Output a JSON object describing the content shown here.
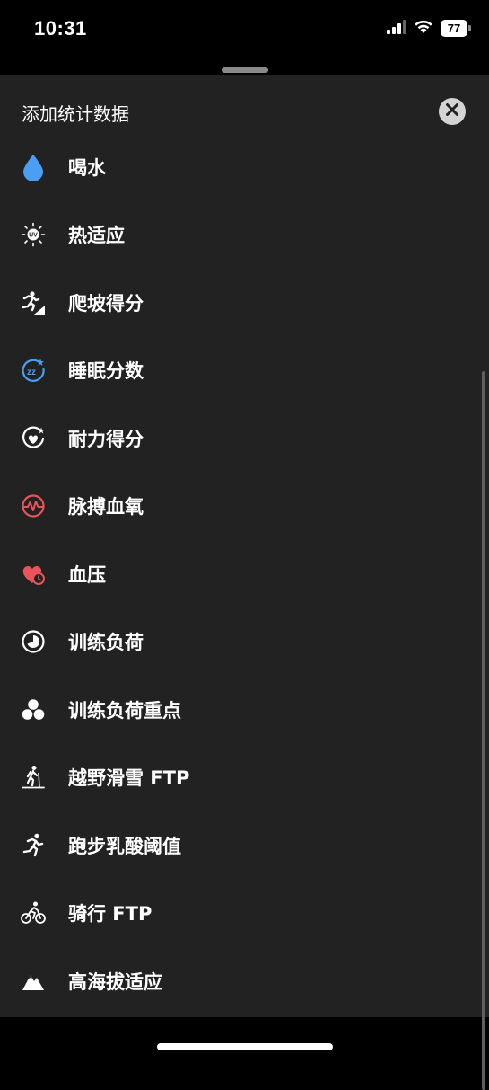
{
  "status_bar": {
    "time": "10:31",
    "battery_level": "77",
    "icons": [
      "cellular-signal-icon",
      "wifi-icon",
      "battery-icon"
    ]
  },
  "sheet": {
    "title": "添加统计数据",
    "close_icon": "close-icon"
  },
  "items": [
    {
      "label": "喝水",
      "icon": "water-drop-icon",
      "color": "#4a9ff5"
    },
    {
      "label": "热适应",
      "icon": "uv-sun-icon",
      "color": "#ffffff"
    },
    {
      "label": "爬坡得分",
      "icon": "climb-runner-icon",
      "color": "#ffffff"
    },
    {
      "label": "睡眠分数",
      "icon": "sleep-score-icon",
      "color": "#4a9ff5"
    },
    {
      "label": "耐力得分",
      "icon": "endurance-heart-icon",
      "color": "#ffffff"
    },
    {
      "label": "脉搏血氧",
      "icon": "pulse-ox-icon",
      "color": "#e8545a"
    },
    {
      "label": "血压",
      "icon": "blood-pressure-heart-icon",
      "color": "#e8545a"
    },
    {
      "label": "训练负荷",
      "icon": "training-load-icon",
      "color": "#ffffff"
    },
    {
      "label": "训练负荷重点",
      "icon": "training-focus-icon",
      "color": "#ffffff"
    },
    {
      "label": "越野滑雪 FTP",
      "icon": "xc-ski-icon",
      "color": "#ffffff"
    },
    {
      "label": "跑步乳酸阈值",
      "icon": "running-icon",
      "color": "#ffffff"
    },
    {
      "label": "骑行 FTP",
      "icon": "cycling-icon",
      "color": "#ffffff"
    },
    {
      "label": "高海拔适应",
      "icon": "mountain-icon",
      "color": "#ffffff"
    }
  ]
}
